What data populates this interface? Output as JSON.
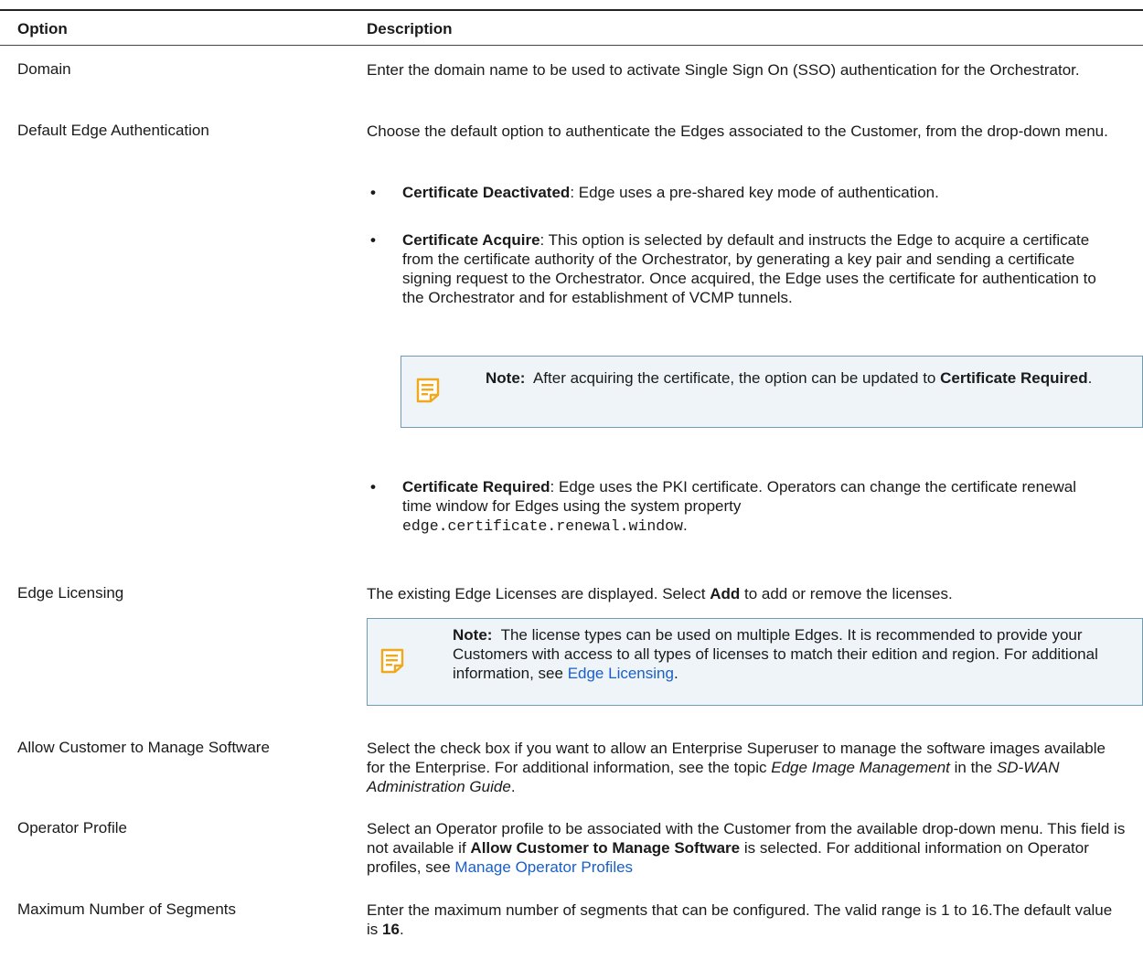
{
  "table": {
    "header_option": "Option",
    "header_description": "Description"
  },
  "rows": {
    "domain": {
      "option": "Domain",
      "description": "Enter the domain name to be used to activate Single Sign On (SSO) authentication for the Orchestrator."
    },
    "default_edge_auth": {
      "option": "Default Edge Authentication",
      "description": "Choose the default option to authenticate the Edges associated to the Customer, from the drop-down menu.",
      "bullets": [
        {
          "term": "Certificate Deactivated",
          "text": ": Edge uses a pre-shared key mode of authentication."
        },
        {
          "term": "Certificate Acquire",
          "text": ": This option is selected by default and instructs the Edge to acquire a certificate from the certificate authority of the Orchestrator, by generating a key pair and sending a certificate signing request to the Orchestrator. Once acquired, the Edge uses the certificate for authentication to the Orchestrator and for establishment of VCMP tunnels."
        },
        {
          "term": "Certificate Required",
          "text": ": Edge uses the PKI certificate. Operators can change the certificate renewal time window for Edges using the system property",
          "code": "edge.certificate.renewal.window",
          "end": "."
        }
      ],
      "note": {
        "label": "Note:",
        "text": "After acquiring the certificate, the option can be updated to",
        "strong": "Certificate Required",
        "end": "."
      }
    },
    "edge_licensing": {
      "option": "Edge Licensing",
      "desc_before": "The existing Edge Licenses are displayed. Select",
      "desc_strong": "Add",
      "desc_after": "to add or remove the licenses.",
      "note": {
        "label": "Note:",
        "text": "The license types can be used on multiple Edges. It is recommended to provide your Customers with access to all types of licenses to match their edition and region. For additional information, see",
        "link": "Edge Licensing",
        "end": "."
      }
    },
    "allow_manage_software": {
      "option": "Allow Customer to Manage Software",
      "desc_before": "Select the check box if you want to allow an Enterprise Superuser to manage the software images available for the Enterprise. For additional information, see the topic",
      "desc_em1": "Edge Image Management",
      "desc_mid": "in the",
      "desc_em2": "SD-WAN Administration Guide",
      "desc_end": "."
    },
    "operator_profile": {
      "option": "Operator Profile",
      "desc_before": "Select an Operator profile to be associated with the Customer from the available drop-down menu. This field is not available if",
      "desc_strong": "Allow Customer to Manage Software",
      "desc_after": "is selected. For additional information on Operator profiles, see",
      "link": "Manage Operator Profiles"
    },
    "max_segments": {
      "option": "Maximum Number of Segments",
      "desc_before": "Enter the maximum number of segments that can be configured. The valid range is 1 to 16.The default value is",
      "desc_strong": "16",
      "desc_end": "."
    }
  },
  "colors": {
    "note_bg": "#eef4f7",
    "note_border": "#6f9bb5",
    "link": "#1a5fc7",
    "note_icon": "#f0a81c"
  },
  "icons": {
    "note": "note-icon"
  }
}
